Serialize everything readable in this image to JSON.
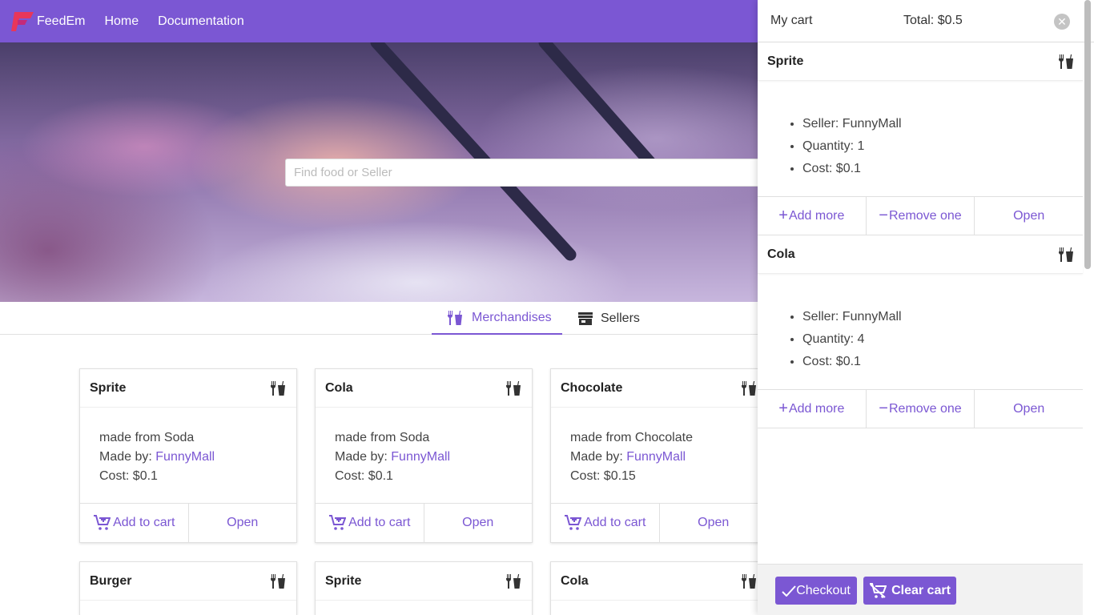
{
  "nav": {
    "brand": "FeedEm",
    "links": [
      "Home",
      "Documentation"
    ]
  },
  "hero": {
    "search_placeholder": "Find food or Seller"
  },
  "tabs": [
    {
      "label": "Merchandises",
      "icon": "fork-knife-cup-icon",
      "active": true
    },
    {
      "label": "Sellers",
      "icon": "store-icon",
      "active": false
    }
  ],
  "cards": [
    {
      "name": "Sprite",
      "desc": "made from Soda",
      "made_by_label": "Made by:",
      "seller": "FunnyMall",
      "cost": "Cost: $0.1",
      "add_label": "Add to cart",
      "open_label": "Open"
    },
    {
      "name": "Cola",
      "desc": "made from Soda",
      "made_by_label": "Made by:",
      "seller": "FunnyMall",
      "cost": "Cost: $0.1",
      "add_label": "Add to cart",
      "open_label": "Open"
    },
    {
      "name": "Chocolate",
      "desc": "made from Chocolate",
      "made_by_label": "Made by:",
      "seller": "FunnyMall",
      "cost": "Cost: $0.15",
      "add_label": "Add to cart",
      "open_label": "Open"
    },
    {
      "name": "Burger"
    },
    {
      "name": "Sprite"
    },
    {
      "name": "Cola"
    }
  ],
  "cart": {
    "title": "My cart",
    "total": "Total: $0.5",
    "items": [
      {
        "name": "Sprite",
        "seller": "Seller: FunnyMall",
        "quantity": "Quantity: 1",
        "cost": "Cost: $0.1",
        "add_more": "Add more",
        "remove_one": "Remove one",
        "open": "Open"
      },
      {
        "name": "Cola",
        "seller": "Seller: FunnyMall",
        "quantity": "Quantity: 4",
        "cost": "Cost: $0.1",
        "add_more": "Add more",
        "remove_one": "Remove one",
        "open": "Open"
      }
    ],
    "checkout_label": "Checkout",
    "clear_label": "Clear cart"
  },
  "colors": {
    "primary": "#7b57d3",
    "logo_red": "#e8365a"
  }
}
